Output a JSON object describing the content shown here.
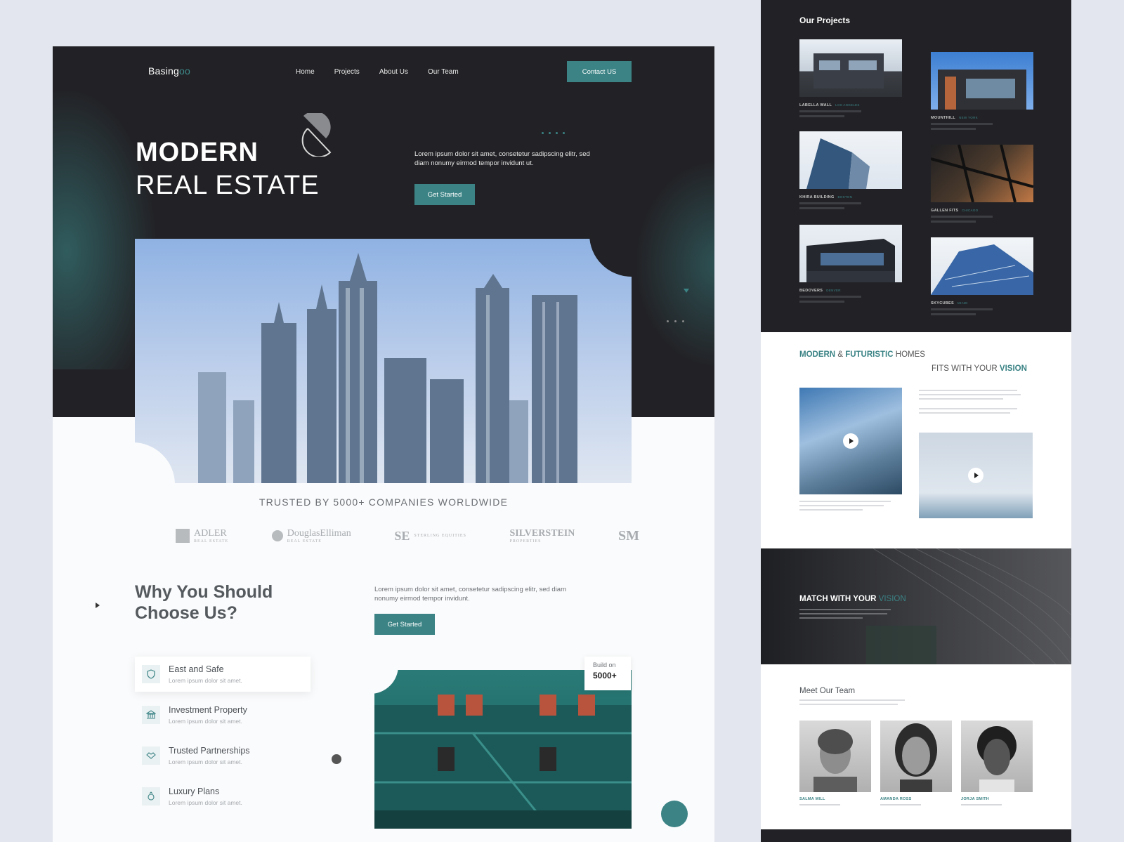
{
  "brand": {
    "name": "Basing",
    "suffix": "oo"
  },
  "nav": [
    "Home",
    "Projects",
    "About Us",
    "Our Team"
  ],
  "contact_button": "Contact US",
  "hero": {
    "title_line1": "MODERN",
    "title_line2": "REAL ESTATE",
    "text": "Lorem ipsum dolor sit amet, consetetur sadipscing elitr, sed diam nonumy eirmod tempor invidunt ut.",
    "cta": "Get Started"
  },
  "trusted": {
    "heading": "TRUSTED BY 5000+ COMPANIES WORLDWIDE",
    "logos": [
      {
        "name": "ADLER",
        "sub": "REAL ESTATE"
      },
      {
        "name": "DouglasElliman",
        "sub": "REAL ESTATE"
      },
      {
        "name": "SE",
        "sub": "STERLING EQUITIES"
      },
      {
        "name": "SILVERSTEIN",
        "sub": "PROPERTIES"
      },
      {
        "name": "SM",
        "sub": ""
      }
    ]
  },
  "why": {
    "title_line1": "Why You Should",
    "title_line2": "Choose Us?",
    "text": "Lorem ipsum dolor sit amet, consetetur sadipscing elitr, sed diam nonumy eirmod tempor invidunt.",
    "cta": "Get Started",
    "features": [
      {
        "title": "East and Safe",
        "sub": "Lorem ipsum dolor sit amet.",
        "icon": "shield-icon"
      },
      {
        "title": "Investment Property",
        "sub": "Lorem ipsum dolor sit amet.",
        "icon": "bank-icon"
      },
      {
        "title": "Trusted Partnerships",
        "sub": "Lorem ipsum dolor sit amet.",
        "icon": "handshake-icon"
      },
      {
        "title": "Luxury Plans",
        "sub": "Lorem ipsum dolor sit amet.",
        "icon": "gem-icon"
      }
    ],
    "badge": {
      "label": "Build on",
      "value": "5000+"
    }
  },
  "projects": {
    "title": "Our Projects",
    "items": [
      {
        "name": "LABELLA WALL",
        "loc": "LOS ANGELES"
      },
      {
        "name": "MOUNTHILL",
        "loc": "NEW YORK"
      },
      {
        "name": "KHIRA BUILDING",
        "loc": "BOSTON"
      },
      {
        "name": "GALLEN FITS",
        "loc": "CHICAGO"
      },
      {
        "name": "BEDOVERS",
        "loc": "DENVER"
      },
      {
        "name": "SKYCUBES",
        "loc": "MIAMI"
      }
    ]
  },
  "modern": {
    "h1_a": "MODERN",
    "h1_b": "&",
    "h1_c": "FUTURISTIC",
    "h1_d": "HOMES",
    "h2_a": "FITS WITH YOUR",
    "h2_b": "VISION"
  },
  "match": {
    "title": "MATCH WITH YOUR",
    "accent": "VISION"
  },
  "team": {
    "title": "Meet Our Team",
    "members": [
      {
        "name": "SALMA MILL"
      },
      {
        "name": "AMANDA ROSS"
      },
      {
        "name": "JORJA SMITH"
      }
    ]
  },
  "colors": {
    "accent": "#3b8385",
    "dark": "#222226",
    "page_bg": "#e3e6ee"
  }
}
